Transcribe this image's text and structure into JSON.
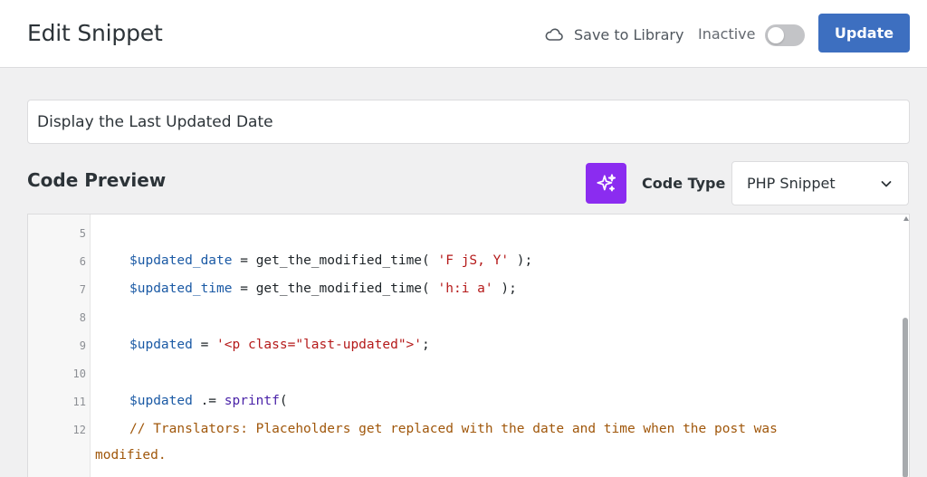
{
  "header": {
    "title": "Edit Snippet",
    "save_to_library": "Save to Library",
    "status_label": "Inactive",
    "active": false,
    "update_label": "Update"
  },
  "snippet": {
    "title_value": "Display the Last Updated Date"
  },
  "code_preview": {
    "heading": "Code Preview",
    "code_type_label": "Code Type",
    "code_type_value": "PHP Snippet"
  },
  "code": {
    "line_numbers": [
      "5",
      "6",
      "7",
      "8",
      "9",
      "10",
      "11",
      "12"
    ],
    "l6": {
      "var": "$updated_date",
      "op": " = ",
      "fn": "get_the_modified_time( ",
      "str": "'F jS, Y'",
      "end": " );"
    },
    "l7": {
      "var": "$updated_time",
      "op": " = ",
      "fn": "get_the_modified_time( ",
      "str": "'h:i a'",
      "end": " );"
    },
    "l9": {
      "var": "$updated",
      "op": " = ",
      "str": "'<p class=\"last-updated\">'",
      "end": ";"
    },
    "l11": {
      "var": "$updated",
      "op": " .= ",
      "fn": "sprintf",
      "end": "("
    },
    "l12": {
      "comment": "// Translators: Placeholders get replaced with the date and time when the post was",
      "wrap": "modified."
    }
  },
  "icons": {
    "cloud": "cloud-icon",
    "ai": "sparkles-icon",
    "chevron": "chevron-down-icon"
  },
  "colors": {
    "primary": "#3d6fc0",
    "ai_accent": "#8b2cf0"
  }
}
